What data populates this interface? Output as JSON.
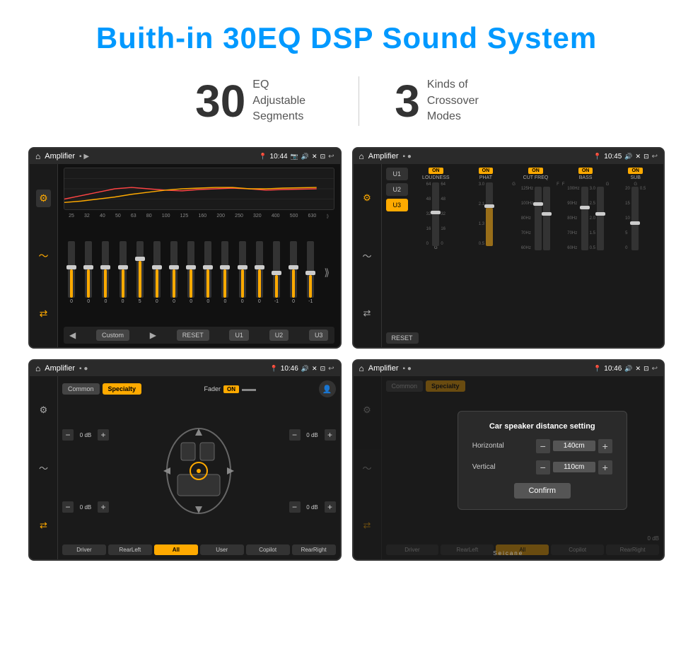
{
  "header": {
    "title": "Buith-in 30EQ DSP Sound System",
    "title_color": "#0099ff"
  },
  "stats": {
    "eq_number": "30",
    "eq_label_line1": "EQ Adjustable",
    "eq_label_line2": "Segments",
    "crossover_number": "3",
    "crossover_label_line1": "Kinds of",
    "crossover_label_line2": "Crossover Modes"
  },
  "screen1": {
    "title": "Amplifier",
    "time": "10:44",
    "eq_bands": [
      "25",
      "32",
      "40",
      "50",
      "63",
      "80",
      "100",
      "125",
      "160",
      "200",
      "250",
      "320",
      "400",
      "500",
      "630"
    ],
    "eq_values": [
      "0",
      "0",
      "0",
      "0",
      "5",
      "0",
      "0",
      "0",
      "0",
      "0",
      "0",
      "0",
      "-1",
      "0",
      "-1"
    ],
    "eq_heights": [
      50,
      50,
      50,
      50,
      65,
      50,
      50,
      50,
      50,
      50,
      50,
      50,
      40,
      50,
      40
    ],
    "bottom_btns": [
      "Custom",
      "RESET",
      "U1",
      "U2",
      "U3"
    ]
  },
  "screen2": {
    "title": "Amplifier",
    "time": "10:45",
    "presets": [
      "U1",
      "U2",
      "U3"
    ],
    "active_preset": "U3",
    "bands": [
      {
        "name": "LOUDNESS",
        "on": true,
        "g_label": "G"
      },
      {
        "name": "PHAT",
        "on": true,
        "g_label": ""
      },
      {
        "name": "CUT FREQ",
        "on": true,
        "g_label": "G",
        "f_label": "F"
      },
      {
        "name": "BASS",
        "on": true,
        "g_label": "G",
        "f_label": "F"
      },
      {
        "name": "SUB",
        "on": true,
        "g_label": "G"
      }
    ],
    "reset_btn": "RESET"
  },
  "screen3": {
    "title": "Amplifier",
    "time": "10:46",
    "preset_btns": [
      "Common",
      "Specialty"
    ],
    "active_preset": "Specialty",
    "fader_label": "Fader",
    "fader_on": "ON",
    "db_controls": [
      {
        "label": "0 dB",
        "position": "top-left"
      },
      {
        "label": "0 dB",
        "position": "top-right"
      },
      {
        "label": "0 dB",
        "position": "bottom-left"
      },
      {
        "label": "0 dB",
        "position": "bottom-right"
      }
    ],
    "speaker_btns": [
      "Driver",
      "RearLeft",
      "All",
      "User",
      "Copilot",
      "RearRight"
    ],
    "active_speaker": "All"
  },
  "screen4": {
    "title": "Amplifier",
    "time": "10:46",
    "preset_btns": [
      "Common",
      "Specialty"
    ],
    "dialog": {
      "title": "Car speaker distance setting",
      "horizontal_label": "Horizontal",
      "horizontal_value": "140cm",
      "vertical_label": "Vertical",
      "vertical_value": "110cm",
      "confirm_label": "Confirm"
    },
    "speaker_btns_right": [
      "0 dB",
      "0 dB"
    ],
    "bottom_btns": [
      "Driver",
      "RearLeft",
      "All",
      "User",
      "Copilot",
      "RearRight"
    ]
  },
  "watermark": "Seicane",
  "icons": {
    "home": "⌂",
    "eq": "≡",
    "wave": "〜",
    "volume": "♪",
    "arrows": "⇄",
    "bluetooth": "℗",
    "forward": "▶",
    "back": "◀",
    "return": "↩",
    "pin": "📍",
    "camera": "📷",
    "sound": "🔊",
    "close": "✕",
    "window": "⊡"
  }
}
